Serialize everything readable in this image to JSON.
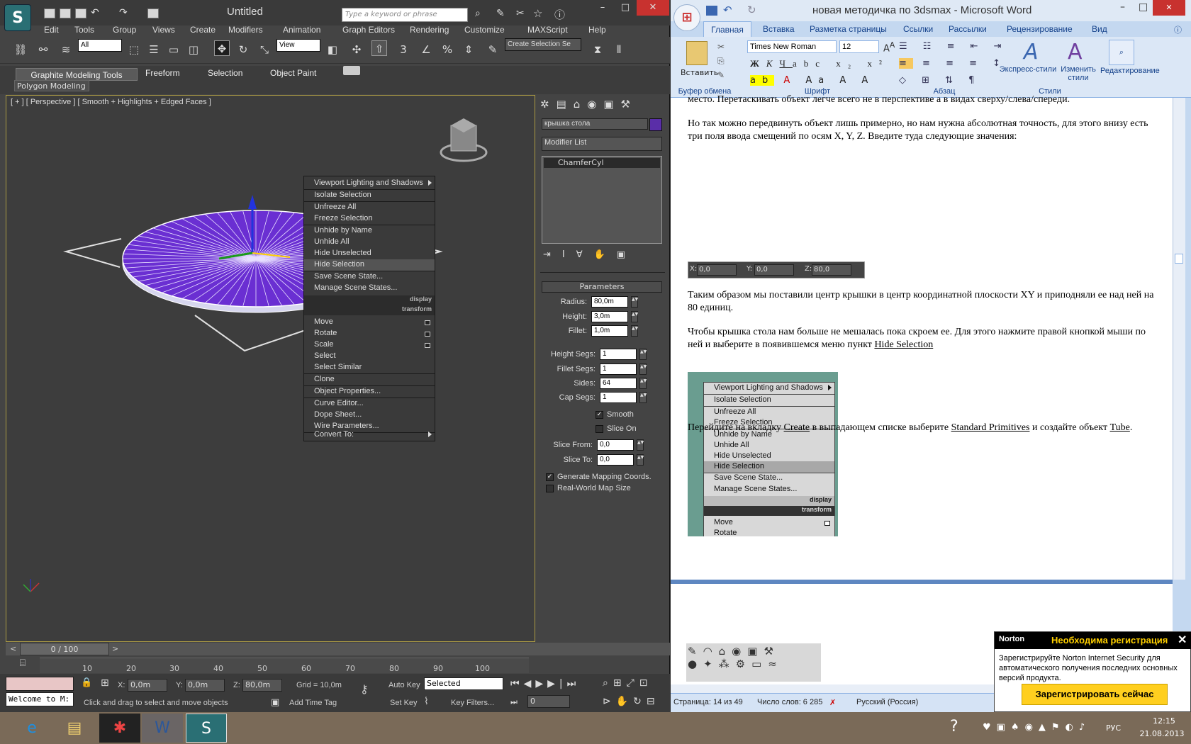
{
  "max": {
    "logo": "S",
    "title": "Untitled",
    "search_placeholder": "Type a keyword or phrase",
    "menu": [
      "Edit",
      "Tools",
      "Group",
      "Views",
      "Create",
      "Modifiers",
      "Animation",
      "Graph Editors",
      "Rendering",
      "Customize",
      "MAXScript",
      "Help"
    ],
    "selection_filter": "All",
    "ref_coord": "View",
    "named_sel": "Create Selection Se",
    "ribbon_tabs": [
      "Graphite Modeling Tools",
      "Freeform",
      "Selection",
      "Object Paint"
    ],
    "ribbon_sub": "Polygon Modeling",
    "viewport_label": "[ + ] [ Perspective ] [ Smooth + Highlights + Edged Faces ]",
    "context_menu": {
      "items": [
        "Viewport Lighting and Shadows",
        "Isolate Selection",
        "Unfreeze All",
        "Freeze Selection",
        "Unhide by Name",
        "Unhide All",
        "Hide Unselected",
        "Hide Selection",
        "Save Scene State...",
        "Manage Scene States..."
      ],
      "header_display": "display",
      "header_transform": "transform",
      "transform_items": [
        "Move",
        "Rotate",
        "Scale",
        "Select",
        "Select Similar",
        "Clone",
        "Object Properties...",
        "Curve Editor...",
        "Dope Sheet...",
        "Wire Parameters...",
        "Convert To:"
      ]
    },
    "command_panel": {
      "object_name": "крышка стола",
      "object_color": "#5a2ea8",
      "modifier_list": "Modifier List",
      "stack_item": "ChamferCyl",
      "rollout_title": "Parameters",
      "radius_label": "Radius:",
      "radius": "80,0m",
      "height_label": "Height:",
      "height": "3,0m",
      "fillet_label": "Fillet:",
      "fillet": "1,0m",
      "height_segs_label": "Height Segs:",
      "height_segs": "1",
      "fillet_segs_label": "Fillet Segs:",
      "fillet_segs": "1",
      "sides_label": "Sides:",
      "sides": "64",
      "cap_segs_label": "Cap Segs:",
      "cap_segs": "1",
      "smooth_label": "Smooth",
      "slice_on_label": "Slice On",
      "slice_from_label": "Slice From:",
      "slice_from": "0,0",
      "slice_to_label": "Slice To:",
      "slice_to": "0,0",
      "gen_map_label": "Generate Mapping Coords.",
      "real_world_label": "Real-World Map Size"
    },
    "timeline": {
      "frame": "0 / 100",
      "ticks": [
        "10",
        "20",
        "30",
        "40",
        "50",
        "60",
        "70",
        "80",
        "90",
        "100"
      ]
    },
    "status": {
      "welcome": "Welcome to M:",
      "x_label": "X:",
      "x": "0,0m",
      "y_label": "Y:",
      "y": "0,0m",
      "z_label": "Z:",
      "z": "80,0m",
      "grid": "Grid = 10,0m",
      "prompt": "Click and drag to select and move objects",
      "add_time_tag": "Add Time Tag",
      "auto_key": "Auto Key",
      "set_key": "Set Key",
      "selected": "Selected",
      "key_filters": "Key Filters...",
      "frame_field": "0"
    }
  },
  "word": {
    "title": "новая методичка по 3dsmax - Microsoft Word",
    "tabs": [
      "Главная",
      "Вставка",
      "Разметка страницы",
      "Ссылки",
      "Рассылки",
      "Рецензирование",
      "Вид"
    ],
    "font_name": "Times New Roman",
    "font_size": "12",
    "paste_label": "Вставить",
    "groups": [
      "Буфер обмена",
      "Шрифт",
      "Абзац",
      "Стили"
    ],
    "express_styles": "Экспресс-стили",
    "change_styles": "Изменить стили",
    "editing": "Редактирование",
    "doc": {
      "p0": "место. Перетаскивать объект легче всего не в перспективе а в видах сверху/слева/спереди.",
      "p1": "Но так можно передвинуть объект лишь примерно, но нам нужна абсолютная точность, для этого внизу есть три поля ввода смещений по осям X, Y, Z. Введите туда следующие значения:",
      "coords": {
        "x_label": "X:",
        "x": "0,0",
        "y_label": "Y:",
        "y": "0,0",
        "z_label": "Z:",
        "z": "80,0"
      },
      "p2": "Таким образом мы поставили центр крышки в центр координатной плоскости XY и приподняли ее над ней на 80 единиц.",
      "p3a": "Чтобы крышка стола нам больше не мешалась пока скроем ее. Для этого нажмите правой кнопкой мыши по ней и выберите в появившемся меню пункт ",
      "p3b": "Hide Selection",
      "img_menu": [
        "Viewport Lighting and Shadows",
        "Isolate Selection",
        "Unfreeze All",
        "Freeze Selection",
        "Unhide by Name",
        "Unhide All",
        "Hide Unselected",
        "Hide Selection",
        "Save Scene State...",
        "Manage Scene States..."
      ],
      "img_display": "display",
      "img_transform": "transform",
      "img_move": "Move",
      "img_rotate": "Rotate",
      "p4a": "Перейдите на вкладку ",
      "p4b": "Create",
      "p4c": " в выпадающем списке выберите ",
      "p4d": "Standard Primitives",
      "p4e": " и создайте объект ",
      "p4f": "Tube",
      "p4g": "."
    },
    "status": {
      "page": "Страница: 14 из 49",
      "words": "Число слов: 6 285",
      "lang": "Русский (Россия)"
    }
  },
  "norton": {
    "brand": "Norton",
    "title": "Необходима регистрация",
    "text": "Зарегистрируйте Norton Internet Security для автоматического получения последних основных версий продукта.",
    "button": "Зарегистрировать сейчас"
  },
  "taskbar": {
    "lang": "РУС",
    "time": "12:15",
    "date": "21.08.2013"
  }
}
